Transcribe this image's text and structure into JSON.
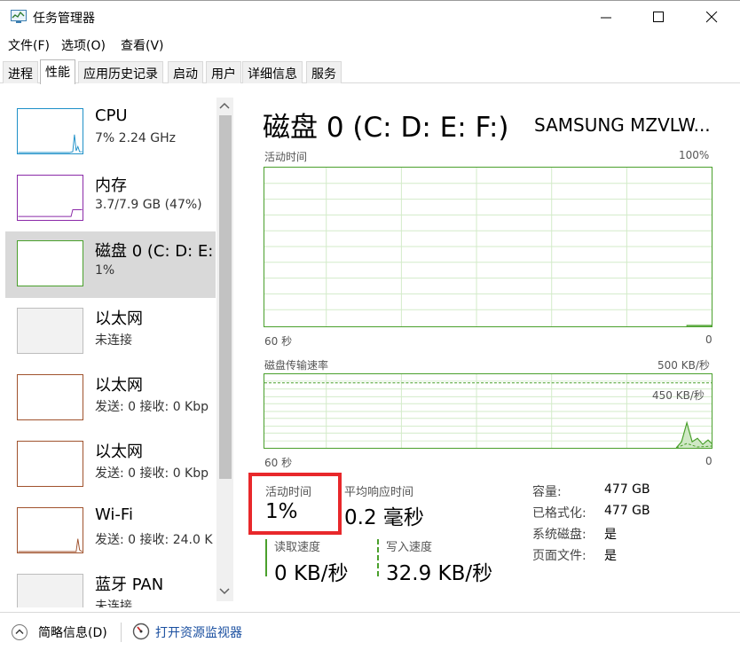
{
  "window": {
    "title": "任务管理器",
    "controls": {
      "minimize": "minimize-icon",
      "maximize": "maximize-icon",
      "close": "close-icon"
    }
  },
  "menu": [
    {
      "label": "文件(F)"
    },
    {
      "label": "选项(O)"
    },
    {
      "label": "查看(V)"
    }
  ],
  "tabs": [
    {
      "label": "进程"
    },
    {
      "label": "性能",
      "active": true
    },
    {
      "label": "应用历史记录"
    },
    {
      "label": "启动"
    },
    {
      "label": "用户"
    },
    {
      "label": "详细信息"
    },
    {
      "label": "服务"
    }
  ],
  "sidebar": {
    "items": [
      {
        "name": "CPU",
        "sub": "7% 2.24 GHz",
        "color": "#1e90c8"
      },
      {
        "name": "内存",
        "sub": "3.7/7.9 GB (47%)",
        "color": "#8b2aa8"
      },
      {
        "name": "磁盘 0 (C: D: E:",
        "sub": "1%",
        "color": "#4aa02c",
        "selected": true
      },
      {
        "name": "以太网",
        "sub": "未连接",
        "color": "#bdbdbd"
      },
      {
        "name": "以太网",
        "sub": "发送: 0 接收: 0 Kbp",
        "color": "#a0522d"
      },
      {
        "name": "以太网",
        "sub": "发送: 0 接收: 0 Kbp",
        "color": "#a0522d"
      },
      {
        "name": "Wi-Fi",
        "sub": "发送: 0 接收: 24.0 K",
        "color": "#a0522d"
      },
      {
        "name": "蓝牙 PAN",
        "sub": "未连接",
        "color": "#bdbdbd"
      }
    ]
  },
  "main": {
    "title": "磁盘 0 (C: D: E: F:)",
    "model": "SAMSUNG MZVLW...",
    "graph1": {
      "label": "活动时间",
      "max": "100%",
      "time": "60 秒",
      "min": "0",
      "recent_activity_percent": [
        0,
        0,
        0.4
      ]
    },
    "graph2": {
      "label": "磁盘传输速率",
      "max": "500 KB/秒",
      "inner": "450 KB/秒",
      "time": "60 秒",
      "min": "0"
    },
    "stats": {
      "active_time_label": "活动时间",
      "active_time_value": "1%",
      "response_label": "平均响应时间",
      "response_value": "0.2 毫秒",
      "read_label": "读取速度",
      "read_value": "0 KB/秒",
      "write_label": "写入速度",
      "write_value": "32.9 KB/秒"
    },
    "info": [
      {
        "label": "容量:",
        "value": "477 GB"
      },
      {
        "label": "已格式化:",
        "value": "477 GB"
      },
      {
        "label": "系统磁盘:",
        "value": "是"
      },
      {
        "label": "页面文件:",
        "value": "是"
      }
    ]
  },
  "footer": {
    "summary": "简略信息(D)",
    "monitor": "打开资源监视器"
  },
  "colors": {
    "disk": "#4aa02c",
    "highlight": "#e8282b",
    "link": "#1a4fa0"
  }
}
